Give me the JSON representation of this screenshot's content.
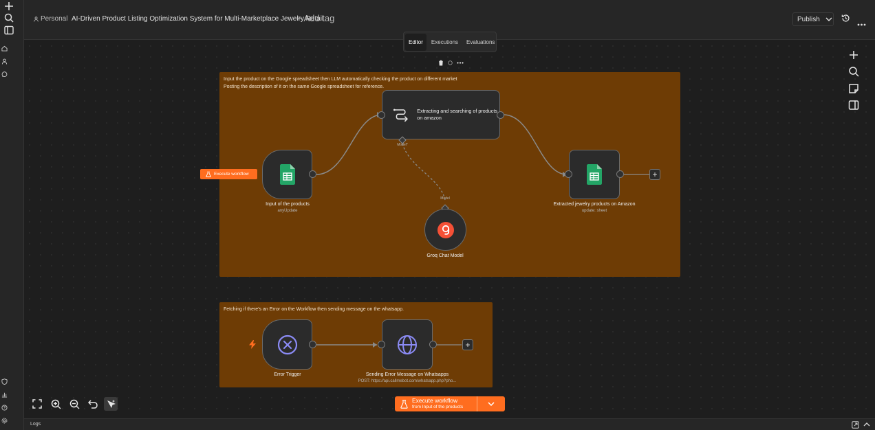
{
  "header": {
    "personal": "Personal",
    "workflow_title": "AI-Driven Product Listing Optimization System for Multi-Marketplace Jewelry Retail",
    "add_tag": "+ Add tag",
    "publish": "Publish"
  },
  "tabs": [
    {
      "label": "Editor",
      "active": true
    },
    {
      "label": "Executions",
      "active": false
    },
    {
      "label": "Evaluations",
      "active": false
    }
  ],
  "sticky_main": {
    "line1": "Input the product on the Google spreadsheet then LLM automatically checking the product on different market",
    "line2": "Posting the description of it on the same Google spreadsheet for reference."
  },
  "sticky_error": {
    "text": "Fetching if there's an Error on the Workflow then sending message on the whatsapp."
  },
  "nodes": {
    "input": {
      "label": "Input of the products",
      "sub": "anyUpdate"
    },
    "agent": {
      "label": "Extracting and searching of products on amazon",
      "model_tag": "Model*"
    },
    "groq": {
      "label": "Groq Chat Model",
      "model_tag": "Model"
    },
    "output": {
      "label": "Extracted jewelry products on Amazon",
      "sub": "update: sheet"
    },
    "error_trigger": {
      "label": "Error Trigger"
    },
    "whatsapp": {
      "label": "Sending Error Message on Whatsapps",
      "sub": "POST: https://api.callmebot.com/whatsapp.php?pho..."
    }
  },
  "execute_pill": "Execute workflow",
  "execute_main": {
    "title": "Execute workflow",
    "subtitle": "from Input of the products"
  },
  "logs": "Logs",
  "colors": {
    "accent": "#ff6d1f",
    "sticky": "#6e3c05",
    "sheets_green": "#23a566",
    "groq_red": "#f55036",
    "error_purple": "#8b8bf5"
  }
}
